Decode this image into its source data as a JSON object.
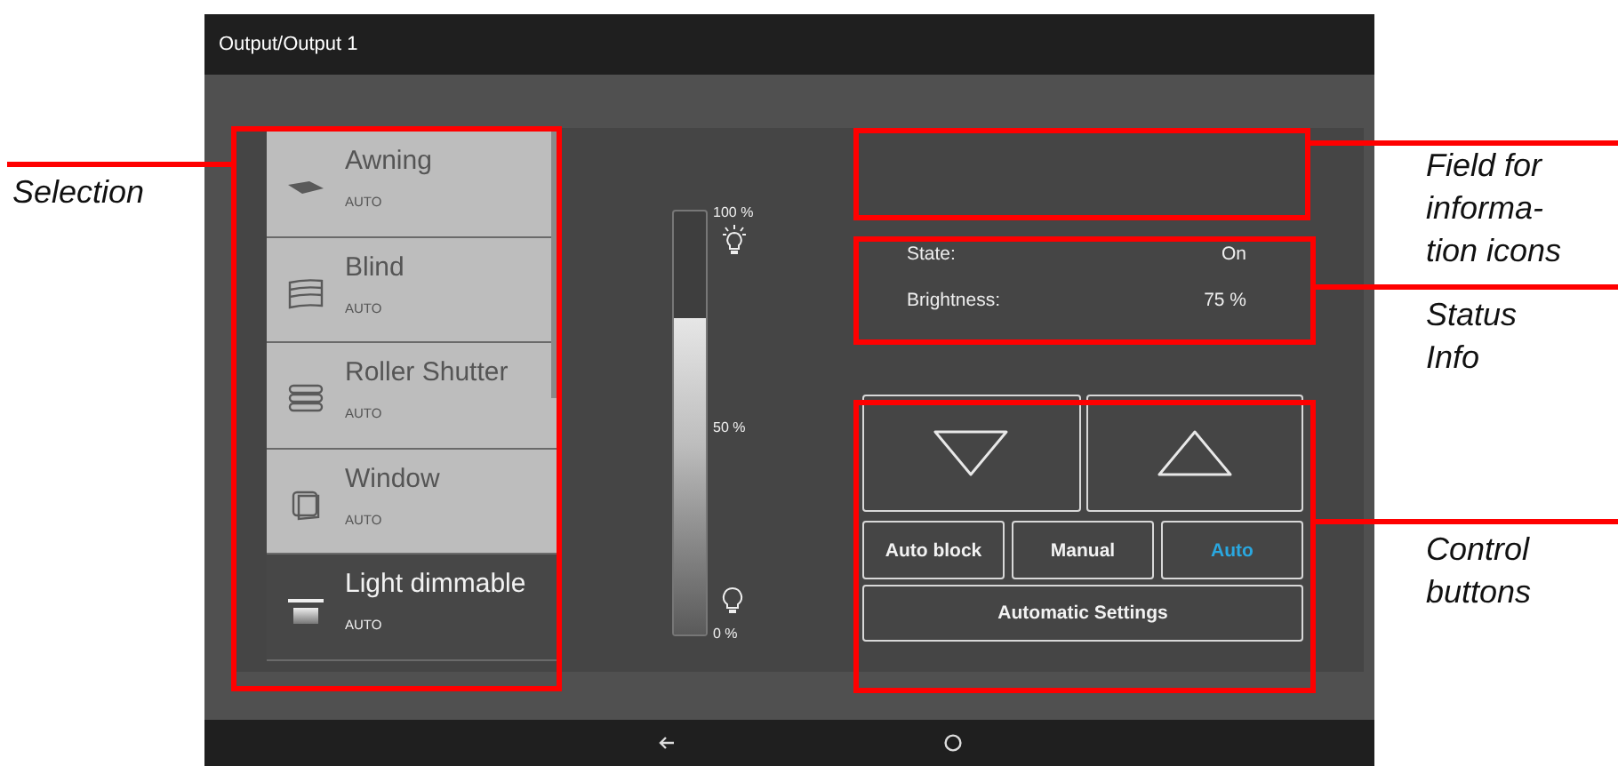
{
  "window": {
    "title": "Output/Output 1"
  },
  "selection": {
    "items": [
      {
        "kind": "awning",
        "name": "Awning",
        "mode": "AUTO",
        "selected": false
      },
      {
        "kind": "blind",
        "name": "Blind",
        "mode": "AUTO",
        "selected": false
      },
      {
        "kind": "roller_shutter",
        "name": "Roller Shutter",
        "mode": "AUTO",
        "selected": false
      },
      {
        "kind": "window",
        "name": "Window",
        "mode": "AUTO",
        "selected": false
      },
      {
        "kind": "light",
        "name": "Light dimmable",
        "mode": "AUTO",
        "selected": true
      }
    ]
  },
  "brightness_slider": {
    "level": 0.75,
    "top_label": "100 %",
    "middle_label": "50 %",
    "bottom_label": "0 %"
  },
  "status": [
    {
      "label": "State:",
      "value": "On"
    },
    {
      "label": "Brightness:",
      "value": "75 %"
    }
  ],
  "controls": {
    "modes": [
      {
        "label": "Auto block",
        "selected": false
      },
      {
        "label": "Manual",
        "selected": false
      },
      {
        "label": "Auto",
        "selected": true
      }
    ],
    "settings_button": "Automatic Settings"
  },
  "annotations": [
    {
      "kind": "selection",
      "label": "Selection"
    },
    {
      "kind": "info_field",
      "label": "Field for informa-tion icons"
    },
    {
      "kind": "status",
      "label": "Status Info"
    },
    {
      "kind": "controls",
      "label": "Control buttons"
    }
  ]
}
